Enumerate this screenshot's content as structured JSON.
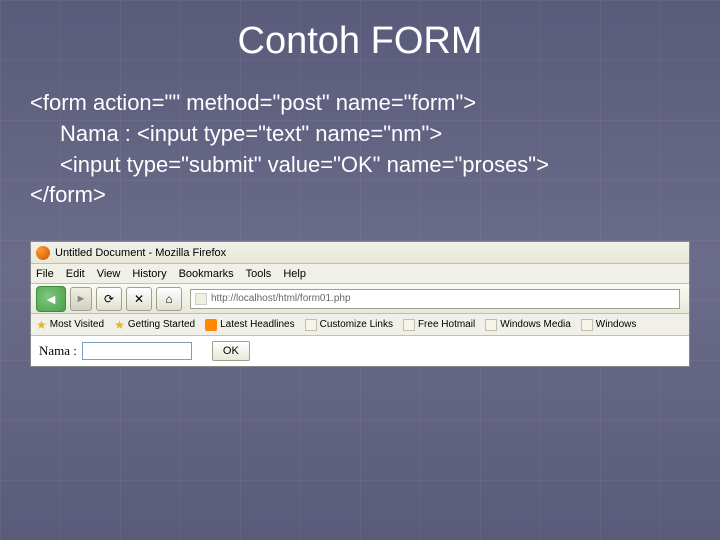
{
  "slide": {
    "title": "Contoh FORM",
    "code": {
      "line1": "<form action=\"\" method=\"post\" name=\"form\">",
      "line2": "Nama : <input type=\"text\" name=\"nm\">",
      "line3": "<input type=\"submit\" value=\"OK\" name=\"proses\">",
      "line4": "</form>"
    }
  },
  "browser": {
    "title": "Untitled Document - Mozilla Firefox",
    "menu": {
      "file": "File",
      "edit": "Edit",
      "view": "View",
      "history": "History",
      "bookmarks": "Bookmarks",
      "tools": "Tools",
      "help": "Help"
    },
    "url": "http://localhost/html/form01.php",
    "bookmarks": {
      "most_visited": "Most Visited",
      "getting_started": "Getting Started",
      "latest_headlines": "Latest Headlines",
      "customize_links": "Customize Links",
      "free_hotmail": "Free Hotmail",
      "windows_media": "Windows Media",
      "windows": "Windows"
    },
    "form": {
      "label": "Nama :",
      "button": "OK"
    }
  }
}
